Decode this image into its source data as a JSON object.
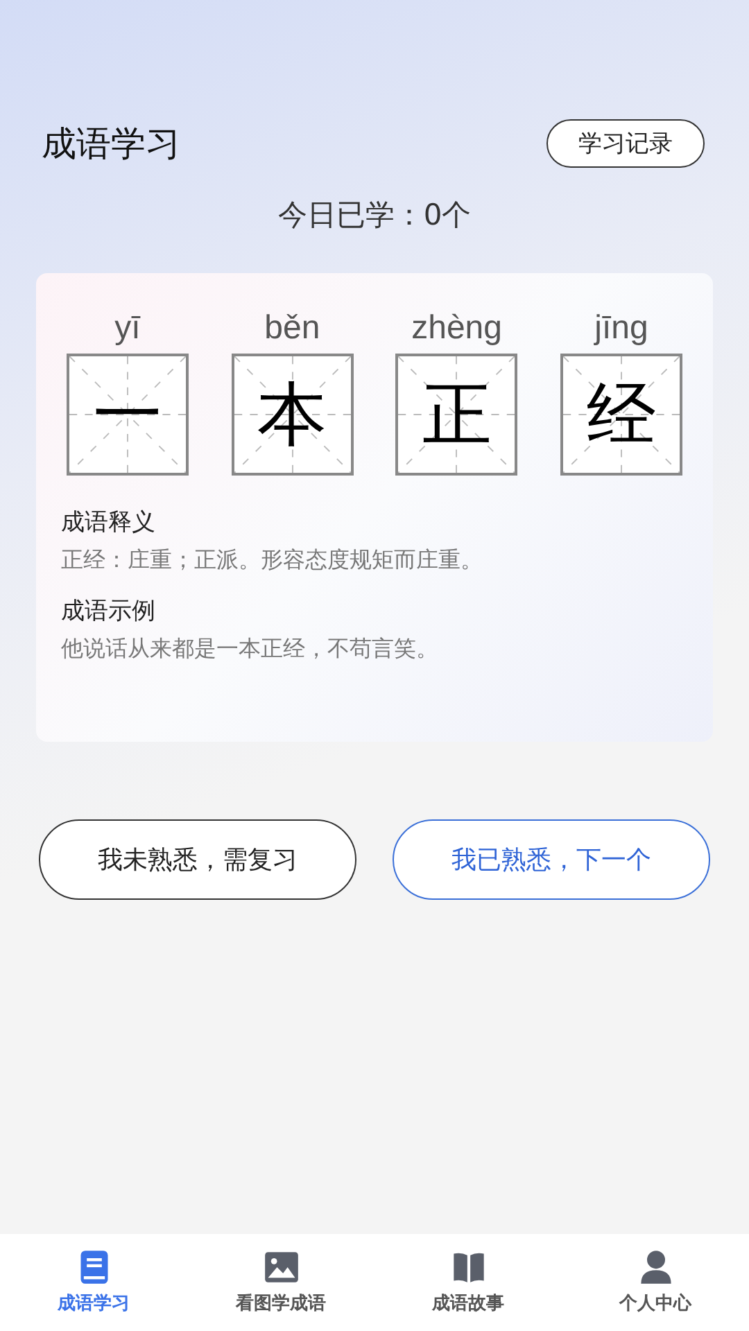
{
  "header": {
    "title": "成语学习",
    "record_button": "学习记录"
  },
  "today": "今日已学：0个",
  "idiom": [
    {
      "pinyin": "yī",
      "char": "一"
    },
    {
      "pinyin": "běn",
      "char": "本"
    },
    {
      "pinyin": "zhèng",
      "char": "正"
    },
    {
      "pinyin": "jīng",
      "char": "经"
    }
  ],
  "sections": [
    {
      "heading": "成语释义",
      "text": "正经：庄重；正派。形容态度规矩而庄重。"
    },
    {
      "heading": "成语示例",
      "text": "他说话从来都是一本正经，不苟言笑。"
    }
  ],
  "actions": [
    {
      "label": "我未熟悉，需复习",
      "kind": "plain"
    },
    {
      "label": "我已熟悉，下一个",
      "kind": "primary"
    }
  ],
  "tabs": [
    {
      "label": "成语学习",
      "kind": "book",
      "selected": true
    },
    {
      "label": "看图学成语",
      "kind": "image",
      "selected": false
    },
    {
      "label": "成语故事",
      "kind": "open-book",
      "selected": false
    },
    {
      "label": "个人中心",
      "kind": "person",
      "selected": false
    }
  ]
}
